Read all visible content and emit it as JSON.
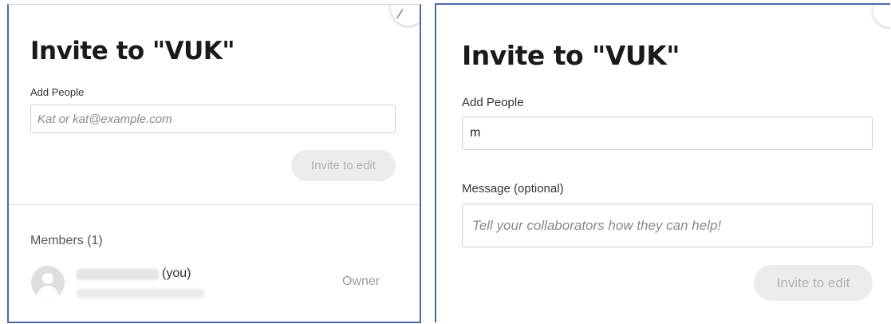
{
  "left_dialog": {
    "title": "Invite to \"VUK\"",
    "add_people_label": "Add People",
    "add_people_placeholder": "Kat or kat@example.com",
    "invite_button": "Invite to edit",
    "members_header": "Members (1)",
    "member": {
      "you_suffix": "(you)",
      "role": "Owner"
    }
  },
  "right_dialog": {
    "title": "Invite to \"VUK\"",
    "add_people_label": "Add People",
    "add_people_value": "m",
    "message_label": "Message (optional)",
    "message_placeholder": "Tell your collaborators how they can help!",
    "invite_button": "Invite to edit"
  },
  "colors": {
    "panel_border": "#4a6aa8",
    "button_disabled_bg": "#ececec",
    "button_disabled_text": "#b3b3b3"
  }
}
